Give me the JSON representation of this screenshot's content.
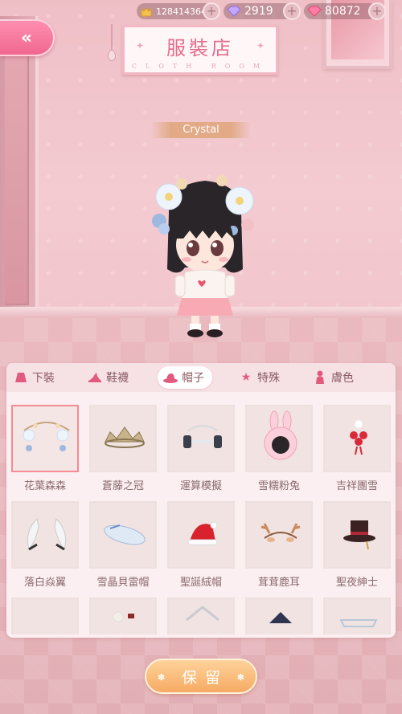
{
  "currency": {
    "gold": "128414364",
    "gems": "2919",
    "pink_gems": "80872",
    "gold_icon": "cat-coin-icon",
    "gem_icon": "purple-diamond-icon",
    "pink_icon": "pink-diamond-icon"
  },
  "back": {
    "icon": "double-chevron-left-icon"
  },
  "sign": {
    "title": "服裝店",
    "subtitle": "CLOTH ROOM"
  },
  "character": {
    "name": "Crystal"
  },
  "tabs": [
    {
      "label": "下裝",
      "icon": "skirt-icon"
    },
    {
      "label": "鞋襪",
      "icon": "high-heel-icon"
    },
    {
      "label": "帽子",
      "icon": "hat-icon",
      "active": true
    },
    {
      "label": "特殊",
      "icon": "star-icon"
    },
    {
      "label": "膚色",
      "icon": "person-icon"
    }
  ],
  "items": [
    {
      "label": "花葉森森",
      "selected": true
    },
    {
      "label": "蒼藤之冠"
    },
    {
      "label": "運算模擬"
    },
    {
      "label": "雪糯粉兔"
    },
    {
      "label": "吉祥團雪"
    },
    {
      "label": "落白焱翼"
    },
    {
      "label": "雪晶貝雷帽"
    },
    {
      "label": "聖誕絨帽"
    },
    {
      "label": "茸茸鹿耳"
    },
    {
      "label": "聖夜紳士"
    }
  ],
  "keep_button": {
    "label": "保留"
  },
  "colors": {
    "accent_pink": "#f0678f",
    "keep_orange": "#f6aa63",
    "panel_bg": "#fbeff1",
    "selected_border": "#f48b95"
  }
}
